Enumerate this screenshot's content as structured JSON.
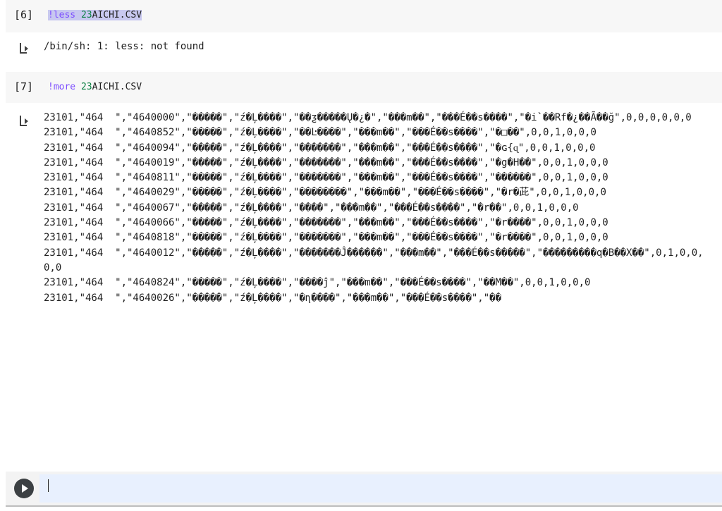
{
  "cells": [
    {
      "number": "[6]",
      "command_bang": "!less ",
      "command_num": "23",
      "command_rest": "AICHI.CSV",
      "output": "/bin/sh: 1: less: not found"
    },
    {
      "number": "[7]",
      "command_bang": "!more ",
      "command_num": "23",
      "command_rest": "AICHI.CSV"
    }
  ],
  "csv_rows": [
    "23101,\"464  \",\"4640000\",\"�����\",\"ź�Ļ����\",\"��ƺ�����Ų�¿�\",\"���m��\",\"���É��s����\",\"�i`��Rf�¿��Ã��ğ\",0,0,0,0,0,0",
    "23101,\"464  \",\"4640852\",\"�����\",\"ź�Ļ����\",\"��Ŀ����\",\"���m��\",\"���É��s����\",\"�□��\",0,0,1,0,0,0",
    "23101,\"464  \",\"4640094\",\"�����\",\"ź�Ļ����\",\"�������\",\"���m��\",\"���É��s����\",\"�ɢ{ɋ\",0,0,1,0,0,0",
    "23101,\"464  \",\"4640019\",\"�����\",\"ź�Ļ����\",\"�������\",\"���m��\",\"���É��s����\",\"�g�H��\",0,0,1,0,0,0",
    "23101,\"464  \",\"4640811\",\"�����\",\"ź�Ļ����\",\"�������\",\"���m��\",\"���É��s����\",\"������\",0,0,1,0,0,0",
    "23101,\"464  \",\"4640029\",\"�����\",\"ź�Ļ����\",\"��������\",\"���m��\",\"���É��s����\",\"�r�茈\",0,0,1,0,0,0",
    "23101,\"464  \",\"4640067\",\"�����\",\"ź�Ļ����\",\"����\",\"���m��\",\"���É��s����\",\"�r��\",0,0,1,0,0,0",
    "23101,\"464  \",\"4640066\",\"�����\",\"ź�Ļ����\",\"�������\",\"���m��\",\"���É��s����\",\"�r����\",0,0,1,0,0,0",
    "23101,\"464  \",\"4640818\",\"�����\",\"ź�Ļ����\",\"�������\",\"���m��\",\"���É��s����\",\"�r����\",0,0,1,0,0,0",
    "23101,\"464  \",\"4640012\",\"�����\",\"ź�Ļ����\",\"�������Ĵ������\",\"���m��\",\"���É��s�����\",\"���������q�B��X��\",0,1,0,0,0,0",
    "23101,\"464  \",\"4640824\",\"�����\",\"ź�Ļ����\",\"����ĵ\",\"���m��\",\"���É��s����\",\"��M��\",0,0,1,0,0,0",
    "23101,\"464  \",\"4640026\",\"�����\",\"ź�Ļ����\",\"�ɳ����\",\"���m��\",\"���É��s����\",\"��"
  ],
  "new_cell": {
    "input_value": ""
  }
}
